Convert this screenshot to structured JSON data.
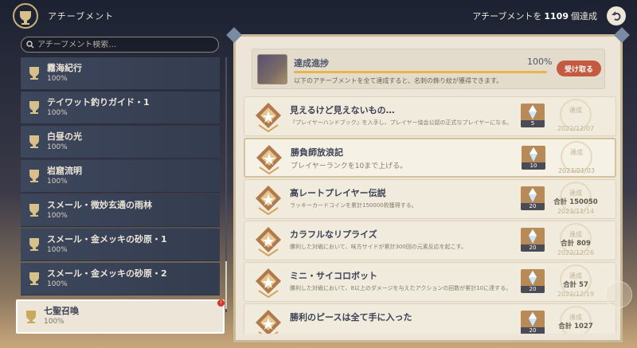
{
  "header": {
    "title": "アチーブメント",
    "tally_prefix": "アチーブメントを",
    "tally_count": "1109",
    "tally_suffix": "個達成"
  },
  "search": {
    "placeholder": "アチーブメント検索…"
  },
  "categories": [
    {
      "name": "霧海紀行",
      "percent": "100%"
    },
    {
      "name": "テイワット釣りガイド・1",
      "percent": "100%"
    },
    {
      "name": "白昼の光",
      "percent": "100%"
    },
    {
      "name": "岩窟流明",
      "percent": "100%"
    },
    {
      "name": "スメール・微妙玄通の雨林",
      "percent": "100%"
    },
    {
      "name": "スメール・金メッキの砂原・1",
      "percent": "100%"
    },
    {
      "name": "スメール・金メッキの砂原・2",
      "percent": "100%"
    },
    {
      "name": "七聖召喚",
      "percent": "100%",
      "selected": true,
      "notification": "!"
    }
  ],
  "summary": {
    "label": "達成進捗",
    "percent": "100%",
    "progress": 1.0,
    "description": "以下のアチーブメントを全て達成すると、名刺の飾り紋が獲得できます。",
    "claim_label": "受け取る"
  },
  "achievements": [
    {
      "name": "見えるけど見えないもの…",
      "description": "『プレイヤーハンドブック』を入手し、プレイヤー協会公認の正式なプレイヤーになる。",
      "reward": "5",
      "status": "達成",
      "total": "",
      "date": "2022/12/07"
    },
    {
      "name": "勝負師放浪記",
      "description": "プレイヤーランクを10まで上げる。",
      "reward": "10",
      "status": "達成",
      "total": "",
      "date": "2023/01/03"
    },
    {
      "name": "高レートプレイヤー伝説",
      "description": "ラッキーカードコインを累計150000枚獲得する。",
      "reward": "20",
      "status": "達成",
      "total": "合計 150050",
      "date": "2023/11/14"
    },
    {
      "name": "カラフルなリプライズ",
      "description": "勝利した対戦において、味方サイドが累計300回の元素反応を起こす。",
      "reward": "20",
      "status": "達成",
      "total": "合計 809",
      "date": "2022/12/26"
    },
    {
      "name": "ミニ・サイコロボット",
      "description": "勝利した対戦において、8以上のダメージを与えたアクションの回数が累計10に達する。",
      "reward": "20",
      "status": "達成",
      "total": "合計 57",
      "date": "2022/12/19"
    },
    {
      "name": "勝利のピースは全て手に入った",
      "description": "",
      "reward": "20",
      "status": "達成",
      "total": "合計 1027",
      "date": ""
    }
  ],
  "colors": {
    "panel_bg": "#ece5d8",
    "claim_button": "#c55a41",
    "progress_fill": "#e9b44c",
    "category_bg": "#3d475c"
  }
}
